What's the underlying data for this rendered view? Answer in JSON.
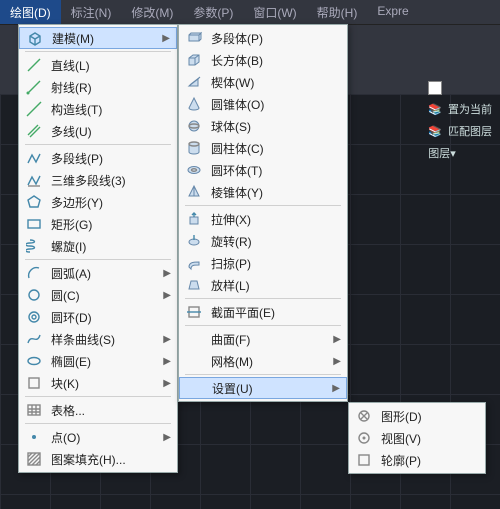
{
  "menubar": [
    "绘图(D)",
    "标注(N)",
    "修改(M)",
    "参数(P)",
    "窗口(W)",
    "帮助(H)",
    "Expre"
  ],
  "menubar_active": 0,
  "rightpanel": {
    "setCurrent": "置为当前",
    "matchLayer": "匹配图层",
    "layerLabel": "图层▾"
  },
  "sub1": [
    {
      "label": "建模(M)",
      "icon": "cube",
      "arrow": true,
      "hl": true
    },
    {
      "sep": true
    },
    {
      "label": "直线(L)",
      "icon": "line"
    },
    {
      "label": "射线(R)",
      "icon": "ray"
    },
    {
      "label": "构造线(T)",
      "icon": "xline"
    },
    {
      "label": "多线(U)",
      "icon": "mline"
    },
    {
      "sep": true
    },
    {
      "label": "多段线(P)",
      "icon": "pline"
    },
    {
      "label": "三维多段线(3)",
      "icon": "pline3d"
    },
    {
      "label": "多边形(Y)",
      "icon": "polygon"
    },
    {
      "label": "矩形(G)",
      "icon": "rect"
    },
    {
      "label": "螺旋(I)",
      "icon": "helix"
    },
    {
      "sep": true
    },
    {
      "label": "圆弧(A)",
      "icon": "arc",
      "arrow": true
    },
    {
      "label": "圆(C)",
      "icon": "circle",
      "arrow": true
    },
    {
      "label": "圆环(D)",
      "icon": "donut"
    },
    {
      "label": "样条曲线(S)",
      "icon": "spline",
      "arrow": true
    },
    {
      "label": "椭圆(E)",
      "icon": "ellipse",
      "arrow": true
    },
    {
      "label": "块(K)",
      "icon": "block",
      "arrow": true
    },
    {
      "sep": true
    },
    {
      "label": "表格...",
      "icon": "table"
    },
    {
      "sep": true
    },
    {
      "label": "点(O)",
      "icon": "point",
      "arrow": true
    },
    {
      "label": "图案填充(H)...",
      "icon": "hatch"
    }
  ],
  "sub2": [
    {
      "label": "多段体(P)",
      "icon": "polysolid"
    },
    {
      "label": "长方体(B)",
      "icon": "box"
    },
    {
      "label": "楔体(W)",
      "icon": "wedge"
    },
    {
      "label": "圆锥体(O)",
      "icon": "cone"
    },
    {
      "label": "球体(S)",
      "icon": "sphere"
    },
    {
      "label": "圆柱体(C)",
      "icon": "cylinder"
    },
    {
      "label": "圆环体(T)",
      "icon": "torus"
    },
    {
      "label": "棱锥体(Y)",
      "icon": "pyramid"
    },
    {
      "sep": true
    },
    {
      "label": "拉伸(X)",
      "icon": "extrude"
    },
    {
      "label": "旋转(R)",
      "icon": "revolve"
    },
    {
      "label": "扫掠(P)",
      "icon": "sweep"
    },
    {
      "label": "放样(L)",
      "icon": "loft"
    },
    {
      "sep": true
    },
    {
      "label": "截面平面(E)",
      "icon": "section"
    },
    {
      "sep": true
    },
    {
      "label": "曲面(F)",
      "icon": "",
      "arrow": true
    },
    {
      "label": "网格(M)",
      "icon": "",
      "arrow": true
    },
    {
      "sep": true
    },
    {
      "label": "设置(U)",
      "icon": "",
      "arrow": true,
      "hl": true
    }
  ],
  "sub3": [
    {
      "label": "图形(D)",
      "icon": "drawing"
    },
    {
      "label": "视图(V)",
      "icon": "view"
    },
    {
      "label": "轮廓(P)",
      "icon": "profile"
    }
  ]
}
